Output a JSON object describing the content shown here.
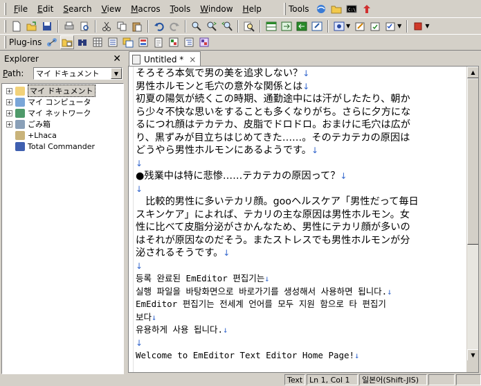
{
  "menubar": {
    "items": [
      {
        "label": "File",
        "u": "F",
        "rest": "ile"
      },
      {
        "label": "Edit",
        "u": "E",
        "rest": "dit"
      },
      {
        "label": "Search",
        "u": "S",
        "rest": "earch"
      },
      {
        "label": "View",
        "u": "V",
        "rest": "iew"
      },
      {
        "label": "Macros",
        "u": "M",
        "rest": "acros"
      },
      {
        "label": "Tools",
        "u": "T",
        "rest": "ools"
      },
      {
        "label": "Window",
        "u": "W",
        "rest": "indow"
      },
      {
        "label": "Help",
        "u": "H",
        "rest": "elp"
      }
    ],
    "tools_label": "Tools"
  },
  "toolbar2": {
    "plugins_label": "Plug-ins"
  },
  "explorer": {
    "title": "Explorer",
    "path_label": "Path:",
    "path_value": "マイ ドキュメント",
    "tree": [
      {
        "label": "マイ ドキュメント",
        "expandable": true,
        "selected": true,
        "icon_color": "#f2d27a"
      },
      {
        "label": "マイ コンピュータ",
        "expandable": true,
        "selected": false,
        "icon_color": "#7aa6d8"
      },
      {
        "label": "マイ ネットワーク",
        "expandable": true,
        "selected": false,
        "icon_color": "#4f9a6a"
      },
      {
        "label": "ごみ箱",
        "expandable": true,
        "selected": false,
        "icon_color": "#8aa0b8"
      },
      {
        "label": "+Lhaca",
        "expandable": false,
        "selected": false,
        "icon_color": "#c9b37a"
      },
      {
        "label": "Total Commander",
        "expandable": false,
        "selected": false,
        "icon_color": "#3f5fb0"
      }
    ]
  },
  "tab": {
    "label": "Untitled *",
    "close": "×"
  },
  "editor": {
    "return_mark": "↓",
    "lines": [
      {
        "text": "そろそろ本気で男の美を追求しない？",
        "mark": true
      },
      {
        "text": "男性ホルモンと毛穴の意外な関係とは",
        "mark": true
      },
      {
        "text": "初夏の陽気が続くこの時期、通勤途中には汗がしたたり、朝か",
        "mark": false
      },
      {
        "text": "ら少々不快な思いをすることも多くなりがち。さらに夕方にな",
        "mark": false
      },
      {
        "text": "るにつれ顔はテカテカ、皮脂でドロドロ。おまけに毛穴は広が",
        "mark": false
      },
      {
        "text": "り、黒ずみが目立ちはじめてきた……。そのテカテカの原因は",
        "mark": false
      },
      {
        "text": "どうやら男性ホルモンにあるようです。",
        "mark": true
      },
      {
        "text": "",
        "mark": true
      },
      {
        "text": "●残業中は特に悲惨……テカテカの原因って？",
        "mark": true
      },
      {
        "text": "",
        "mark": true
      },
      {
        "text": "　比較的男性に多いテカリ顔。gooヘルスケア「男性だって毎日",
        "mark": false
      },
      {
        "text": "スキンケア」によれば、テカリの主な原因は男性ホルモン。女",
        "mark": false
      },
      {
        "text": "性に比べて皮脂分泌がさかんなため、男性にテカリ顔が多いの",
        "mark": false
      },
      {
        "text": "はそれが原因なのだそう。またストレスでも男性ホルモンが分",
        "mark": false
      },
      {
        "text": "泌されるそうです。",
        "mark": true
      },
      {
        "text": "",
        "mark": true
      },
      {
        "text": "등록 완료된 EmEditor 편집기는",
        "mark": true,
        "mono": true
      },
      {
        "text": "실행 파일을 바탕화면으로 바로가기를 생성해서 사용하면 됩니다.",
        "mark": true,
        "mono": true
      },
      {
        "text": "EmEditor 편집기는 전세계 언어를 모두 지원 함으로 타 편집기",
        "mark": false,
        "mono": true
      },
      {
        "text": "보다",
        "mark": true,
        "mono": true
      },
      {
        "text": "유용하게 사용 됩니다.",
        "mark": true,
        "mono": true
      },
      {
        "text": "",
        "mark": true
      },
      {
        "text": "Welcome to EmEditor Text Editor Home Page!",
        "mark": true,
        "mono": true
      }
    ]
  },
  "statusbar": {
    "mode": "Text",
    "position": "Ln 1, Col 1",
    "encoding": "일본어(Shift-JIS)"
  }
}
